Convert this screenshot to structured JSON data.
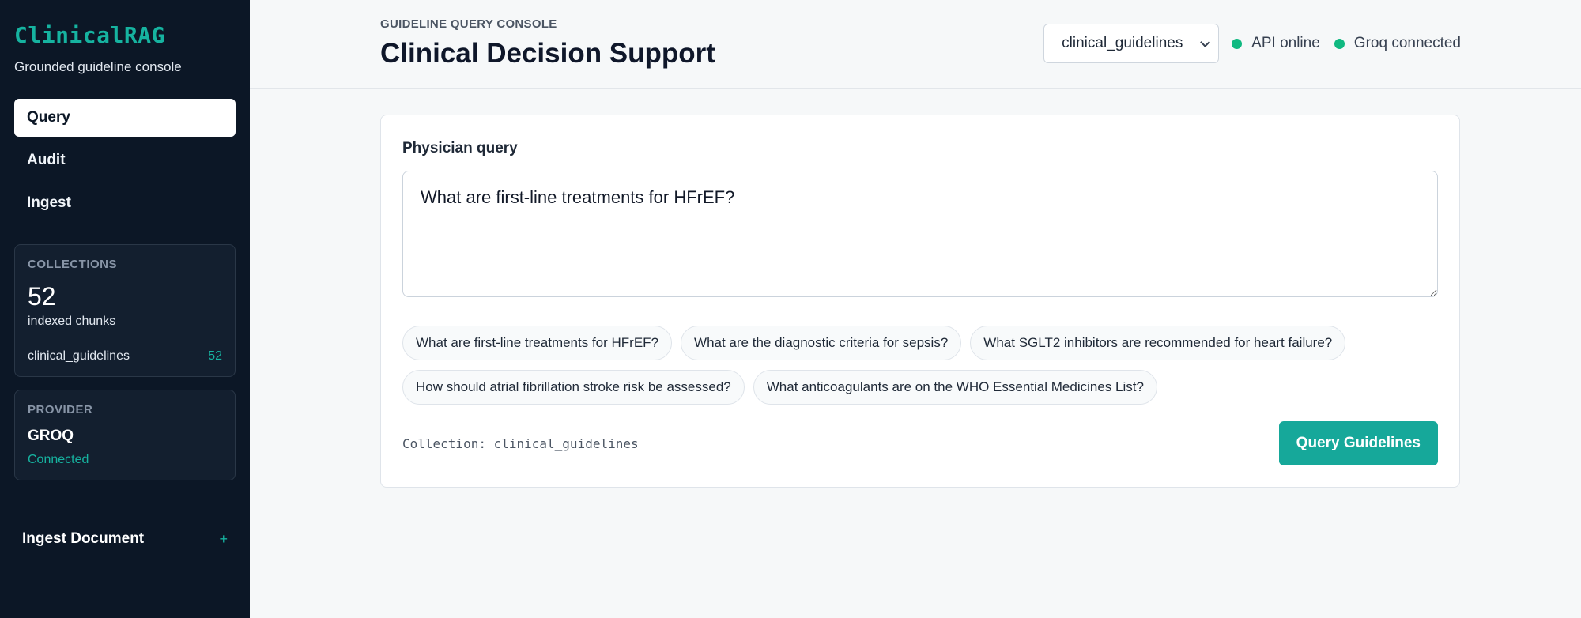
{
  "sidebar": {
    "brand": "ClinicalRAG",
    "subtitle": "Grounded guideline console",
    "nav": [
      {
        "label": "Query",
        "active": true
      },
      {
        "label": "Audit",
        "active": false
      },
      {
        "label": "Ingest",
        "active": false
      }
    ],
    "collections": {
      "heading": "COLLECTIONS",
      "count": "52",
      "count_label": "indexed chunks",
      "items": [
        {
          "name": "clinical_guidelines",
          "count": "52"
        }
      ]
    },
    "provider": {
      "heading": "PROVIDER",
      "name": "GROQ",
      "status": "Connected"
    },
    "ingest": {
      "label": "Ingest Document",
      "icon": "+"
    }
  },
  "header": {
    "eyebrow": "GUIDELINE QUERY CONSOLE",
    "title": "Clinical Decision Support",
    "collection_select": "clinical_guidelines",
    "statuses": [
      "API online",
      "Groq connected"
    ]
  },
  "query": {
    "label": "Physician query",
    "value": "What are first-line treatments for HFrEF?",
    "suggestions": [
      "What are first-line treatments for HFrEF?",
      "What are the diagnostic criteria for sepsis?",
      "What SGLT2 inhibitors are recommended for heart failure?",
      "How should atrial fibrillation stroke risk be assessed?",
      "What anticoagulants are on the WHO Essential Medicines List?"
    ],
    "collection_meta": "Collection: clinical_guidelines",
    "submit_label": "Query Guidelines"
  },
  "colors": {
    "accent": "#16a89a",
    "sidebar_bg": "#0c1726",
    "status_dot": "#10b981"
  }
}
